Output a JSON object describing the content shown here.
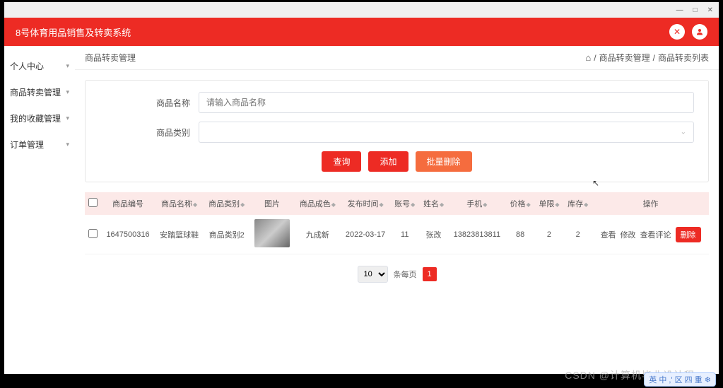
{
  "window": {
    "min": "—",
    "max": "□",
    "close": "✕"
  },
  "header": {
    "title": "8号体育用品销售及转卖系统"
  },
  "sidebar": {
    "items": [
      {
        "label": "个人中心"
      },
      {
        "label": "商品转卖管理"
      },
      {
        "label": "我的收藏管理"
      },
      {
        "label": "订单管理"
      }
    ]
  },
  "breadcrumb": {
    "page": "商品转卖管理",
    "path1": "商品转卖管理",
    "path2": "商品转卖列表"
  },
  "search": {
    "name_label": "商品名称",
    "name_placeholder": "请输入商品名称",
    "cat_label": "商品类别",
    "btn_query": "查询",
    "btn_add": "添加",
    "btn_bulkdel": "批量删除"
  },
  "table": {
    "headers": {
      "id": "商品编号",
      "name": "商品名称",
      "cat": "商品类别",
      "img": "图片",
      "color": "商品成色",
      "pubtime": "发布时间",
      "acct": "账号",
      "uname": "姓名",
      "phone": "手机",
      "price": "价格",
      "limit": "单限",
      "stock": "库存",
      "ops": "操作"
    },
    "rows": [
      {
        "id": "1647500316",
        "name": "安踏篮球鞋",
        "cat": "商品类别2",
        "color": "九成新",
        "pubtime": "2022-03-17",
        "acct": "11",
        "uname": "张改",
        "phone": "13823813811",
        "price": "88",
        "limit": "2",
        "stock": "2"
      }
    ],
    "op_view": "查看",
    "op_edit": "修改",
    "op_cmt": "查看评论",
    "op_del": "删除"
  },
  "pager": {
    "size": "10",
    "per": "条每页",
    "cur": "1"
  },
  "watermark": "CSDN @计算机毕业设计程",
  "float_label": "英 中 ,' 区 四 重 ❄"
}
